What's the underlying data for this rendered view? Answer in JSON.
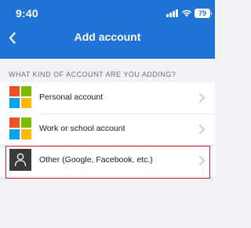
{
  "status_bar": {
    "time": "9:40",
    "battery": "79"
  },
  "navbar": {
    "title": "Add account",
    "back_icon": "chevron-left-icon"
  },
  "section": {
    "header": "WHAT KIND OF ACCOUNT ARE YOU ADDING?"
  },
  "accounts": [
    {
      "label": "Personal account",
      "icon": "microsoft-logo-icon"
    },
    {
      "label": "Work or school account",
      "icon": "microsoft-logo-icon"
    },
    {
      "label": "Other (Google, Facebook, etc.)",
      "icon": "person-icon"
    }
  ],
  "colors": {
    "accent": "#1f73d6",
    "highlight_border": "#d11a2a",
    "ms_red": "#f25022",
    "ms_green": "#7fba00",
    "ms_blue": "#00a4ef",
    "ms_yellow": "#ffb900"
  }
}
